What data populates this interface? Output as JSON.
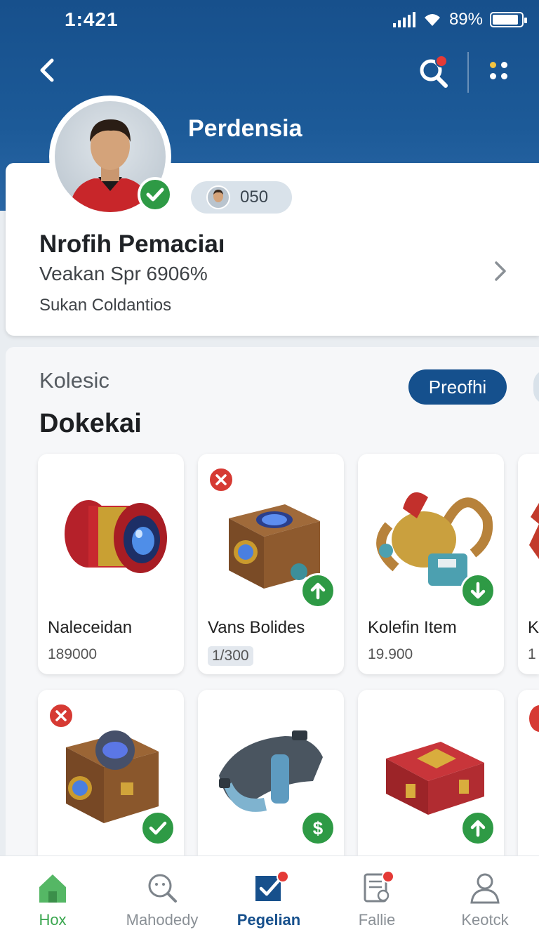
{
  "status_bar": {
    "time": "1:421",
    "battery": "89%",
    "battery_level": 0.89
  },
  "header": {
    "title": "Perdensia"
  },
  "profile": {
    "points": "050",
    "name": "Nrofih Pemaciaı",
    "subtitle": "Veakan Spr 6906%",
    "detail": "Sukan Coldantios"
  },
  "collection": {
    "label": "Kolesic",
    "title": "Dokekai",
    "action_label": "Preofhi",
    "items": [
      {
        "name": "Naleceidan",
        "price": "189000",
        "badge": "none",
        "art": "red-scope"
      },
      {
        "name": "Vans Bolides",
        "price": "1/300",
        "badge": "x+up",
        "art": "chest-blue"
      },
      {
        "name": "Kolefin Item",
        "price": "19.900",
        "badge": "down",
        "art": "mecha-helmet"
      },
      {
        "name": "K",
        "price": "1",
        "badge": "none",
        "art": "partial"
      },
      {
        "name": "",
        "price": "",
        "badge": "x+check",
        "art": "chest-gear"
      },
      {
        "name": "",
        "price": "",
        "badge": "dollar",
        "art": "gauntlet"
      },
      {
        "name": "",
        "price": "",
        "badge": "up",
        "art": "red-box"
      }
    ]
  },
  "tabs": [
    {
      "label": "Hox",
      "icon": "home-icon"
    },
    {
      "label": "Mahodedy",
      "icon": "search-face-icon"
    },
    {
      "label": "Pegelian",
      "icon": "checkbox-icon"
    },
    {
      "label": "Fallie",
      "icon": "document-icon"
    },
    {
      "label": "Keotck",
      "icon": "person-icon"
    }
  ],
  "colors": {
    "header": "#17508c",
    "accent": "#15508d",
    "success": "#2e9a45",
    "danger": "#d63a33"
  }
}
